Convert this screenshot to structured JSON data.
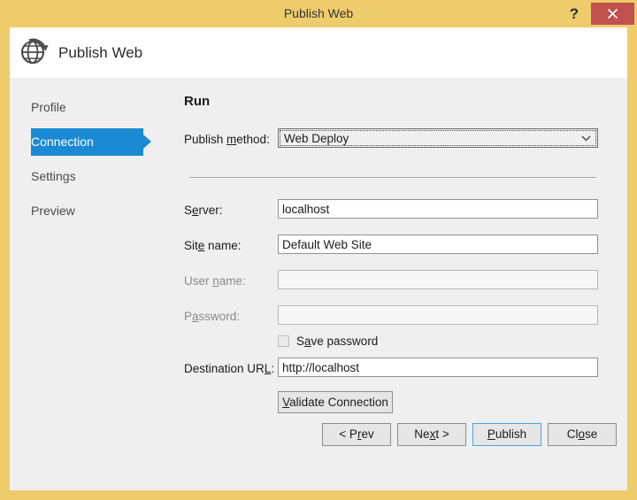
{
  "window": {
    "title": "Publish Web",
    "help_label": "?",
    "close_label": "✕",
    "colors": {
      "titlebar": "#efcc6b",
      "close_button": "#c2504d",
      "client_background": "#efefef",
      "header_band": "#ffffff",
      "accent_selected": "#1a8ad4",
      "default_button_border": "#4aa3e8"
    }
  },
  "header": {
    "icon": "globe-refresh-icon",
    "title": "Publish Web"
  },
  "sidebar": {
    "items": [
      {
        "label": "Profile",
        "selected": false
      },
      {
        "label": "Connection",
        "selected": true
      },
      {
        "label": "Settings",
        "selected": false
      },
      {
        "label": "Preview",
        "selected": false
      }
    ]
  },
  "main": {
    "section_title": "Run",
    "publish_method": {
      "label_pre": "Publish ",
      "label_acc": "m",
      "label_post": "ethod:",
      "value": "Web Deploy",
      "arrow_icon": "chevron-down-icon"
    },
    "fields": [
      {
        "label_pre": "S",
        "label_acc": "e",
        "label_post": "rver:",
        "value": "localhost",
        "placeholder": "",
        "disabled": false,
        "name": "server"
      },
      {
        "label_pre": "Sit",
        "label_acc": "e",
        "label_post": " name:",
        "value": "Default Web Site",
        "placeholder": "",
        "disabled": false,
        "name": "site-name"
      },
      {
        "label_pre": "User ",
        "label_acc": "n",
        "label_post": "ame:",
        "value": "",
        "placeholder": "",
        "disabled": true,
        "name": "user-name"
      },
      {
        "label_pre": "P",
        "label_acc": "a",
        "label_post": "ssword:",
        "value": "",
        "placeholder": "",
        "disabled": true,
        "name": "password"
      }
    ],
    "save_password": {
      "label_pre": "S",
      "label_acc": "a",
      "label_post": "ve password",
      "checked": false
    },
    "destination_url": {
      "label_pre": "Destination UR",
      "label_acc": "L",
      "label_post": ":",
      "value": "http://localhost",
      "placeholder": ""
    },
    "validate_button": {
      "label_pre": "",
      "label_acc": "V",
      "label_post": "alidate Connection"
    }
  },
  "footer": {
    "buttons": [
      {
        "label_pre": "< P",
        "label_acc": "r",
        "label_post": "ev",
        "name": "prev",
        "default": false
      },
      {
        "label_pre": "Ne",
        "label_acc": "x",
        "label_post": "t >",
        "name": "next",
        "default": false
      },
      {
        "label_pre": "",
        "label_acc": "P",
        "label_post": "ublish",
        "name": "publish",
        "default": true
      },
      {
        "label_pre": "Cl",
        "label_acc": "o",
        "label_post": "se",
        "name": "close",
        "default": false
      }
    ]
  }
}
